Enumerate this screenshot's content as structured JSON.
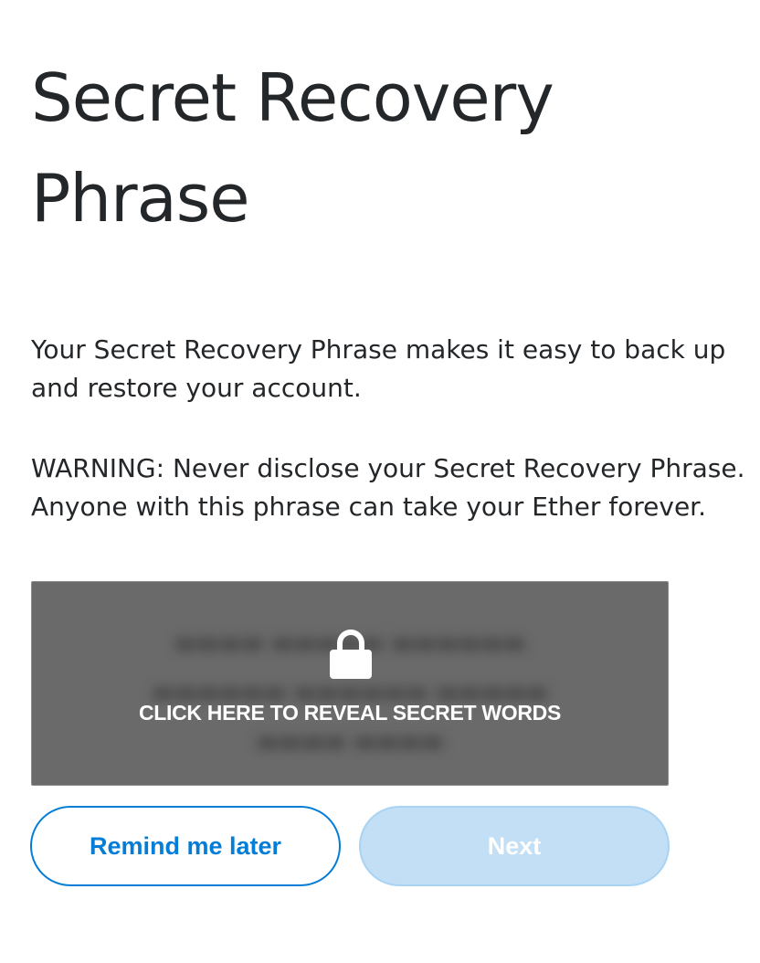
{
  "header": {
    "title": "Secret Recovery Phrase"
  },
  "content": {
    "description": "Your Secret Recovery Phrase makes it easy to back up and restore your account.",
    "warning": "WARNING: Never disclose your Secret Recovery Phrase. Anyone with this phrase can take your Ether forever."
  },
  "reveal": {
    "label": "CLICK HERE TO REVEAL SECRET WORDS",
    "icon": "lock-icon"
  },
  "actions": {
    "remind_label": "Remind me later",
    "next_label": "Next"
  },
  "colors": {
    "primary": "#037dd6",
    "next_disabled_bg": "#c2dff5",
    "reveal_overlay": "#6a6a6a",
    "text": "#24272a"
  }
}
